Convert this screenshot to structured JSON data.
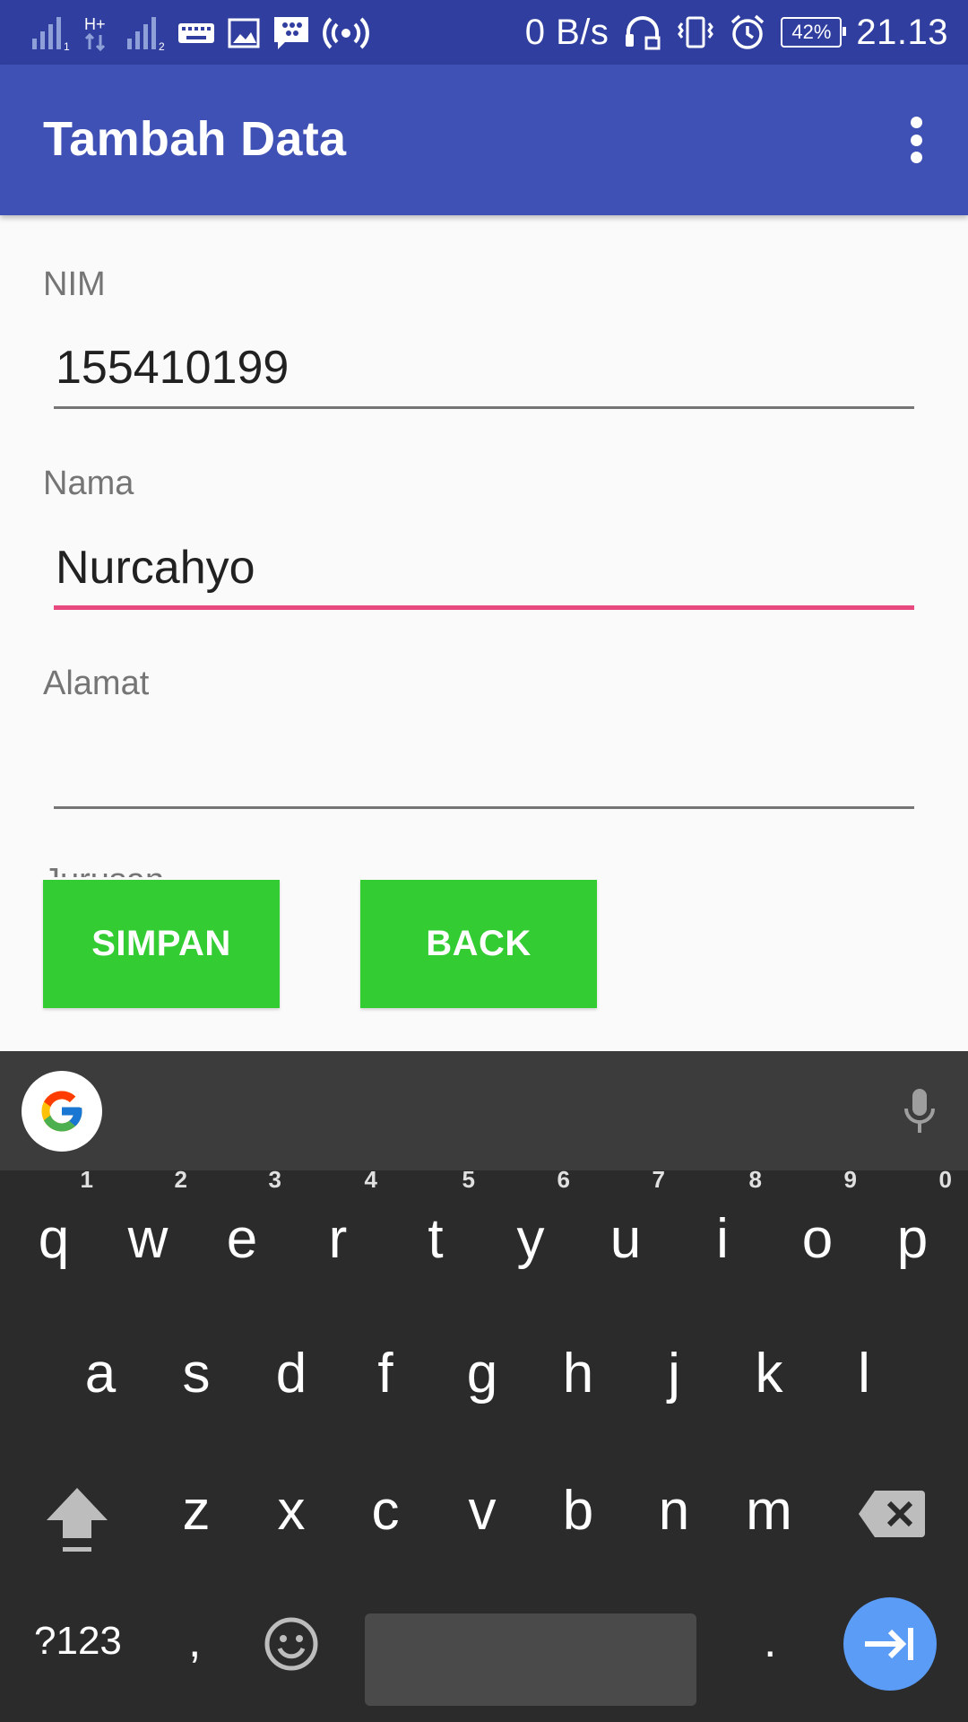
{
  "status_bar": {
    "net_speed": "0 B/s",
    "battery": "42%",
    "time": "21.13"
  },
  "app_bar": {
    "title": "Tambah Data",
    "menu_icon": "overflow-menu-icon"
  },
  "form": {
    "nim_label": "NIM",
    "nim_value": "155410199",
    "nama_label": "Nama",
    "nama_value": "Nurcahyo",
    "alamat_label": "Alamat",
    "alamat_value": "",
    "jurusan_label": "Jurusan"
  },
  "buttons": {
    "simpan": "SIMPAN",
    "back": "BACK"
  },
  "keyboard": {
    "row1": [
      {
        "key": "q",
        "hint": "1"
      },
      {
        "key": "w",
        "hint": "2"
      },
      {
        "key": "e",
        "hint": "3"
      },
      {
        "key": "r",
        "hint": "4"
      },
      {
        "key": "t",
        "hint": "5"
      },
      {
        "key": "y",
        "hint": "6"
      },
      {
        "key": "u",
        "hint": "7"
      },
      {
        "key": "i",
        "hint": "8"
      },
      {
        "key": "o",
        "hint": "9"
      },
      {
        "key": "p",
        "hint": "0"
      }
    ],
    "row2": [
      "a",
      "s",
      "d",
      "f",
      "g",
      "h",
      "j",
      "k",
      "l"
    ],
    "row3": [
      "z",
      "x",
      "c",
      "v",
      "b",
      "n",
      "m"
    ],
    "symbols_label": "?123",
    "comma": ",",
    "period": ".",
    "accent_color": "#5b9cf6"
  }
}
